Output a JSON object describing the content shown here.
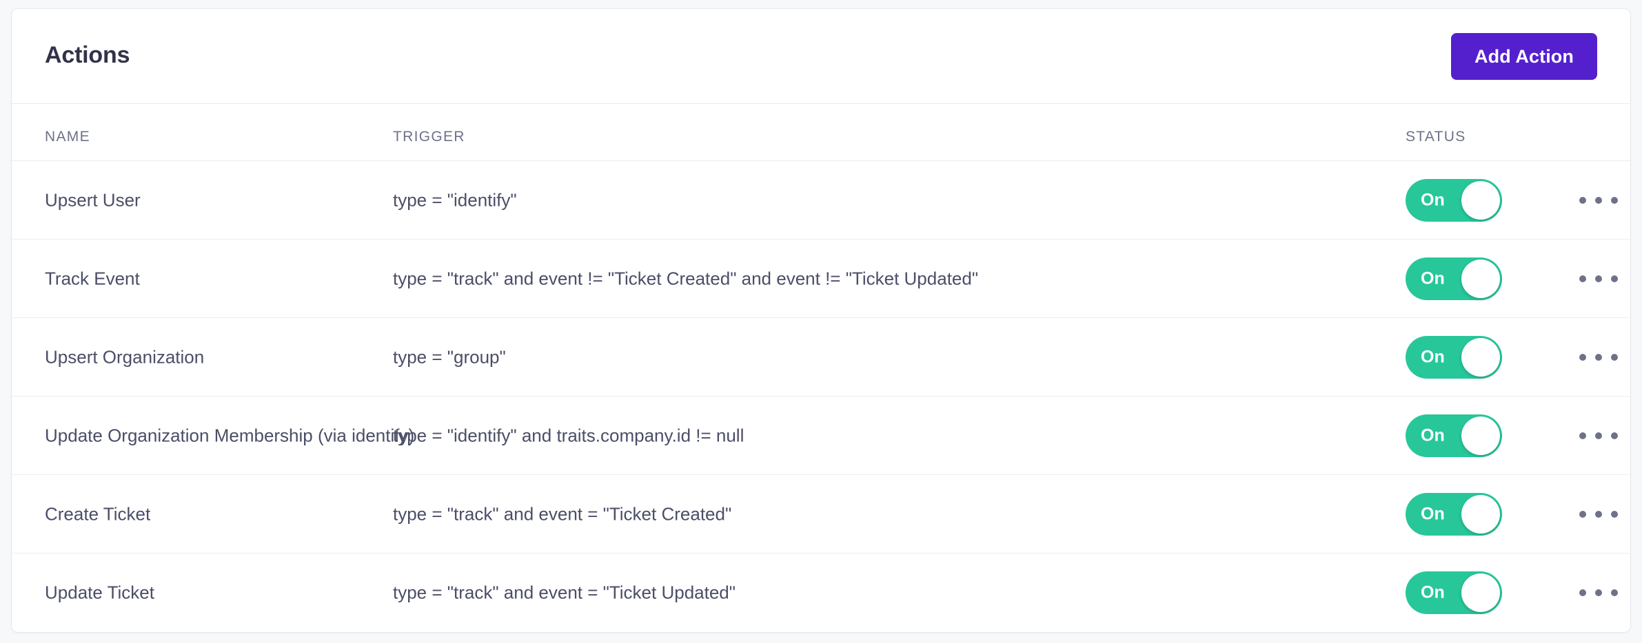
{
  "card": {
    "title": "Actions",
    "add_button_label": "Add Action",
    "accent_color": "#5420ce",
    "toggle_on_color": "#27c79a"
  },
  "table": {
    "columns": [
      {
        "key": "name",
        "label": "NAME"
      },
      {
        "key": "trigger",
        "label": "TRIGGER"
      },
      {
        "key": "status",
        "label": "STATUS"
      }
    ],
    "rows": [
      {
        "name": "Upsert User",
        "trigger": "type = \"identify\"",
        "status_label": "On",
        "status_on": true,
        "menu_icon": "ellipsis-horizontal-icon"
      },
      {
        "name": "Track Event",
        "trigger": "type = \"track\" and event != \"Ticket Created\" and event != \"Ticket Updated\"",
        "status_label": "On",
        "status_on": true,
        "menu_icon": "ellipsis-horizontal-icon"
      },
      {
        "name": "Upsert Organization",
        "trigger": "type = \"group\"",
        "status_label": "On",
        "status_on": true,
        "menu_icon": "ellipsis-horizontal-icon"
      },
      {
        "name": "Update Organization Membership (via identify)",
        "trigger": "type = \"identify\" and traits.company.id != null",
        "status_label": "On",
        "status_on": true,
        "menu_icon": "ellipsis-horizontal-icon"
      },
      {
        "name": "Create Ticket",
        "trigger": "type = \"track\" and event = \"Ticket Created\"",
        "status_label": "On",
        "status_on": true,
        "menu_icon": "ellipsis-horizontal-icon"
      },
      {
        "name": "Update Ticket",
        "trigger": "type = \"track\" and event = \"Ticket Updated\"",
        "status_label": "On",
        "status_on": true,
        "menu_icon": "ellipsis-horizontal-icon"
      }
    ]
  }
}
